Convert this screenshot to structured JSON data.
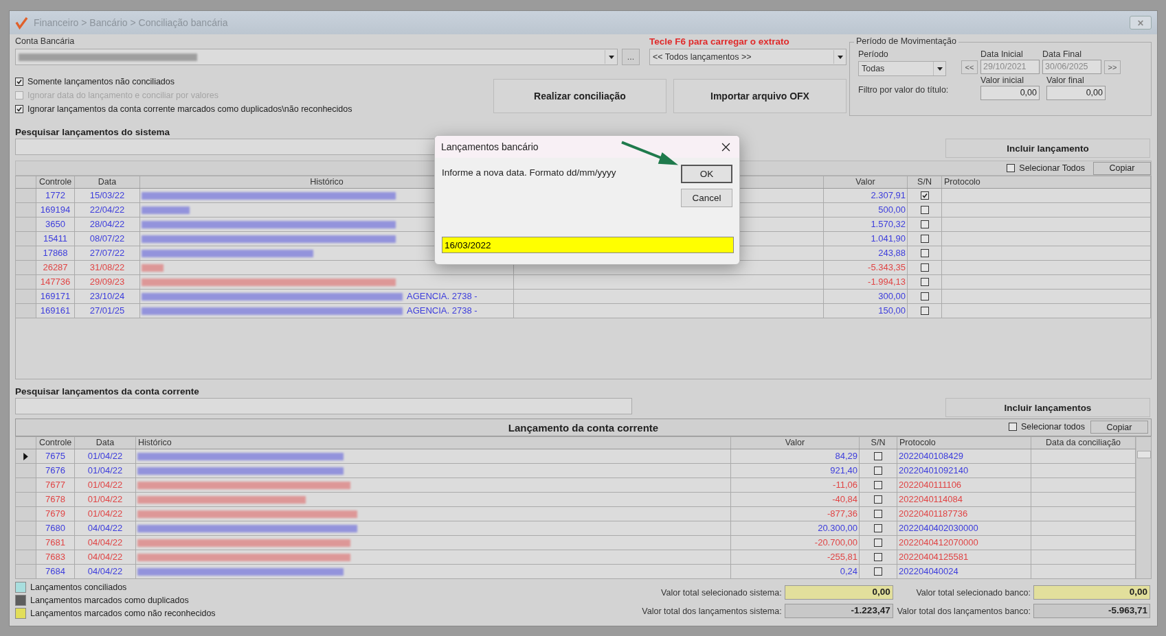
{
  "window": {
    "title": "Financeiro > Bancário > Conciliação bancária"
  },
  "conta": {
    "label": "Conta Bancária",
    "more_button": "..."
  },
  "extrato": {
    "hint": "Tecle F6 para carregar o extrato",
    "select": "<< Todos lançamentos >>"
  },
  "options": [
    {
      "label": "Somente lançamentos não conciliados",
      "checked": true,
      "disabled": false
    },
    {
      "label": "Ignorar data do lançamento e conciliar por valores",
      "checked": false,
      "disabled": true
    },
    {
      "label": "Ignorar lançamentos da conta corrente marcados como duplicados\\não reconhecidos",
      "checked": true,
      "disabled": false
    }
  ],
  "actions": [
    "Realizar conciliação",
    "Importar arquivo OFX"
  ],
  "periodo": {
    "title": "Período de Movimentação",
    "periodo_label": "Período",
    "periodo_value": "Todas",
    "prev": "<<",
    "next": ">>",
    "data_inicial_label": "Data Inicial",
    "data_inicial": "29/10/2021",
    "data_final_label": "Data Final",
    "data_final": "30/06/2025",
    "filtro_label": "Filtro por valor do título:",
    "valor_inicial_label": "Valor inicial",
    "valor_inicial": "0,00",
    "valor_final_label": "Valor final",
    "valor_final": "0,00"
  },
  "system": {
    "search_label": "Pesquisar lançamentos do sistema",
    "include_button": "Incluir lançamento",
    "select_all": {
      "label": "Selecionar Todos",
      "checked": false
    },
    "copy_button": "Copiar",
    "columns": [
      "Controle",
      "Data",
      "Histórico",
      "Valor",
      "S/N",
      "Protocolo"
    ],
    "rows": [
      {
        "controle": "1772",
        "data": "15/03/22",
        "historico_tail": "",
        "valor": "2.307,91",
        "sn": true,
        "color": "#3c3cdc"
      },
      {
        "controle": "169194",
        "data": "22/04/22",
        "historico_tail": "",
        "valor": "500,00",
        "sn": false,
        "color": "#3c3cdc"
      },
      {
        "controle": "3650",
        "data": "28/04/22",
        "historico_tail": "",
        "valor": "1.570,32",
        "sn": false,
        "color": "#3c3cdc"
      },
      {
        "controle": "15411",
        "data": "08/07/22",
        "historico_tail": "",
        "valor": "1.041,90",
        "sn": false,
        "color": "#3c3cdc"
      },
      {
        "controle": "17868",
        "data": "27/07/22",
        "historico_tail": "",
        "valor": "243,88",
        "sn": false,
        "color": "#3c3cdc"
      },
      {
        "controle": "26287",
        "data": "31/08/22",
        "historico_tail": "",
        "valor": "-5.343,35",
        "sn": false,
        "color": "#e04444"
      },
      {
        "controle": "147736",
        "data": "29/09/23",
        "historico_tail": "",
        "valor": "-1.994,13",
        "sn": false,
        "color": "#e04444"
      },
      {
        "controle": "169171",
        "data": "23/10/24",
        "historico_tail": "AGENCIA. 2738 -",
        "valor": "300,00",
        "sn": false,
        "color": "#3c3cdc"
      },
      {
        "controle": "169161",
        "data": "27/01/25",
        "historico_tail": "AGENCIA. 2738 -",
        "valor": "150,00",
        "sn": false,
        "color": "#3c3cdc"
      }
    ]
  },
  "bank": {
    "search_label": "Pesquisar lançamentos da conta corrente",
    "include_button": "Incluir lançamentos",
    "title": "Lançamento da conta corrente",
    "select_all": {
      "label": "Selecionar todos",
      "checked": false
    },
    "copy_button": "Copiar",
    "columns": [
      "Controle",
      "Data",
      "Histórico",
      "Valor",
      "S/N",
      "Protocolo",
      "Data da conciliação"
    ],
    "rows": [
      {
        "controle": "7675",
        "data": "01/04/22",
        "valor": "84,29",
        "sn": false,
        "protocolo": "2022040108429",
        "color": "#3c3cdc",
        "current": true
      },
      {
        "controle": "7676",
        "data": "01/04/22",
        "valor": "921,40",
        "sn": false,
        "protocolo": "20220401092140",
        "color": "#3c3cdc",
        "current": false
      },
      {
        "controle": "7677",
        "data": "01/04/22",
        "valor": "-11,06",
        "sn": false,
        "protocolo": "2022040111106",
        "color": "#e04444",
        "current": false
      },
      {
        "controle": "7678",
        "data": "01/04/22",
        "valor": "-40,84",
        "sn": false,
        "protocolo": "2022040114084",
        "color": "#e04444",
        "current": false
      },
      {
        "controle": "7679",
        "data": "01/04/22",
        "valor": "-877,36",
        "sn": false,
        "protocolo": "20220401187736",
        "color": "#e04444",
        "current": false
      },
      {
        "controle": "7680",
        "data": "04/04/22",
        "valor": "20.300,00",
        "sn": false,
        "protocolo": "2022040402030000",
        "color": "#3c3cdc",
        "current": false
      },
      {
        "controle": "7681",
        "data": "04/04/22",
        "valor": "-20.700,00",
        "sn": false,
        "protocolo": "2022040412070000",
        "color": "#e04444",
        "current": false
      },
      {
        "controle": "7683",
        "data": "04/04/22",
        "valor": "-255,81",
        "sn": false,
        "protocolo": "20220404125581",
        "color": "#e04444",
        "current": false
      },
      {
        "controle": "7684",
        "data": "04/04/22",
        "valor": "0,24",
        "sn": false,
        "protocolo": "202204040024",
        "color": "#3c3cdc",
        "current": false
      }
    ]
  },
  "legend": [
    {
      "label": "Lançamentos conciliados",
      "color": "#a8dede"
    },
    {
      "label": "Lançamentos marcados como duplicados",
      "color": "#5e5e5e"
    },
    {
      "label": "Lançamentos marcados como não reconhecidos",
      "color": "#e2de5a"
    }
  ],
  "totals": [
    {
      "label": "Valor total selecionado sistema:",
      "value": "0,00",
      "kind": "selected"
    },
    {
      "label": "Valor total selecionado banco:",
      "value": "0,00",
      "kind": "selected"
    },
    {
      "label": "Valor total dos lançamentos sistema:",
      "value": "-1.223,47",
      "kind": "total"
    },
    {
      "label": "Valor total dos lançamentos banco:",
      "value": "-5.963,71",
      "kind": "total"
    }
  ],
  "dialog": {
    "title": "Lançamentos bancário",
    "message": "Informe a nova data. Formato dd/mm/yyyy",
    "ok": "OK",
    "cancel": "Cancel",
    "value": "16/03/2022"
  }
}
